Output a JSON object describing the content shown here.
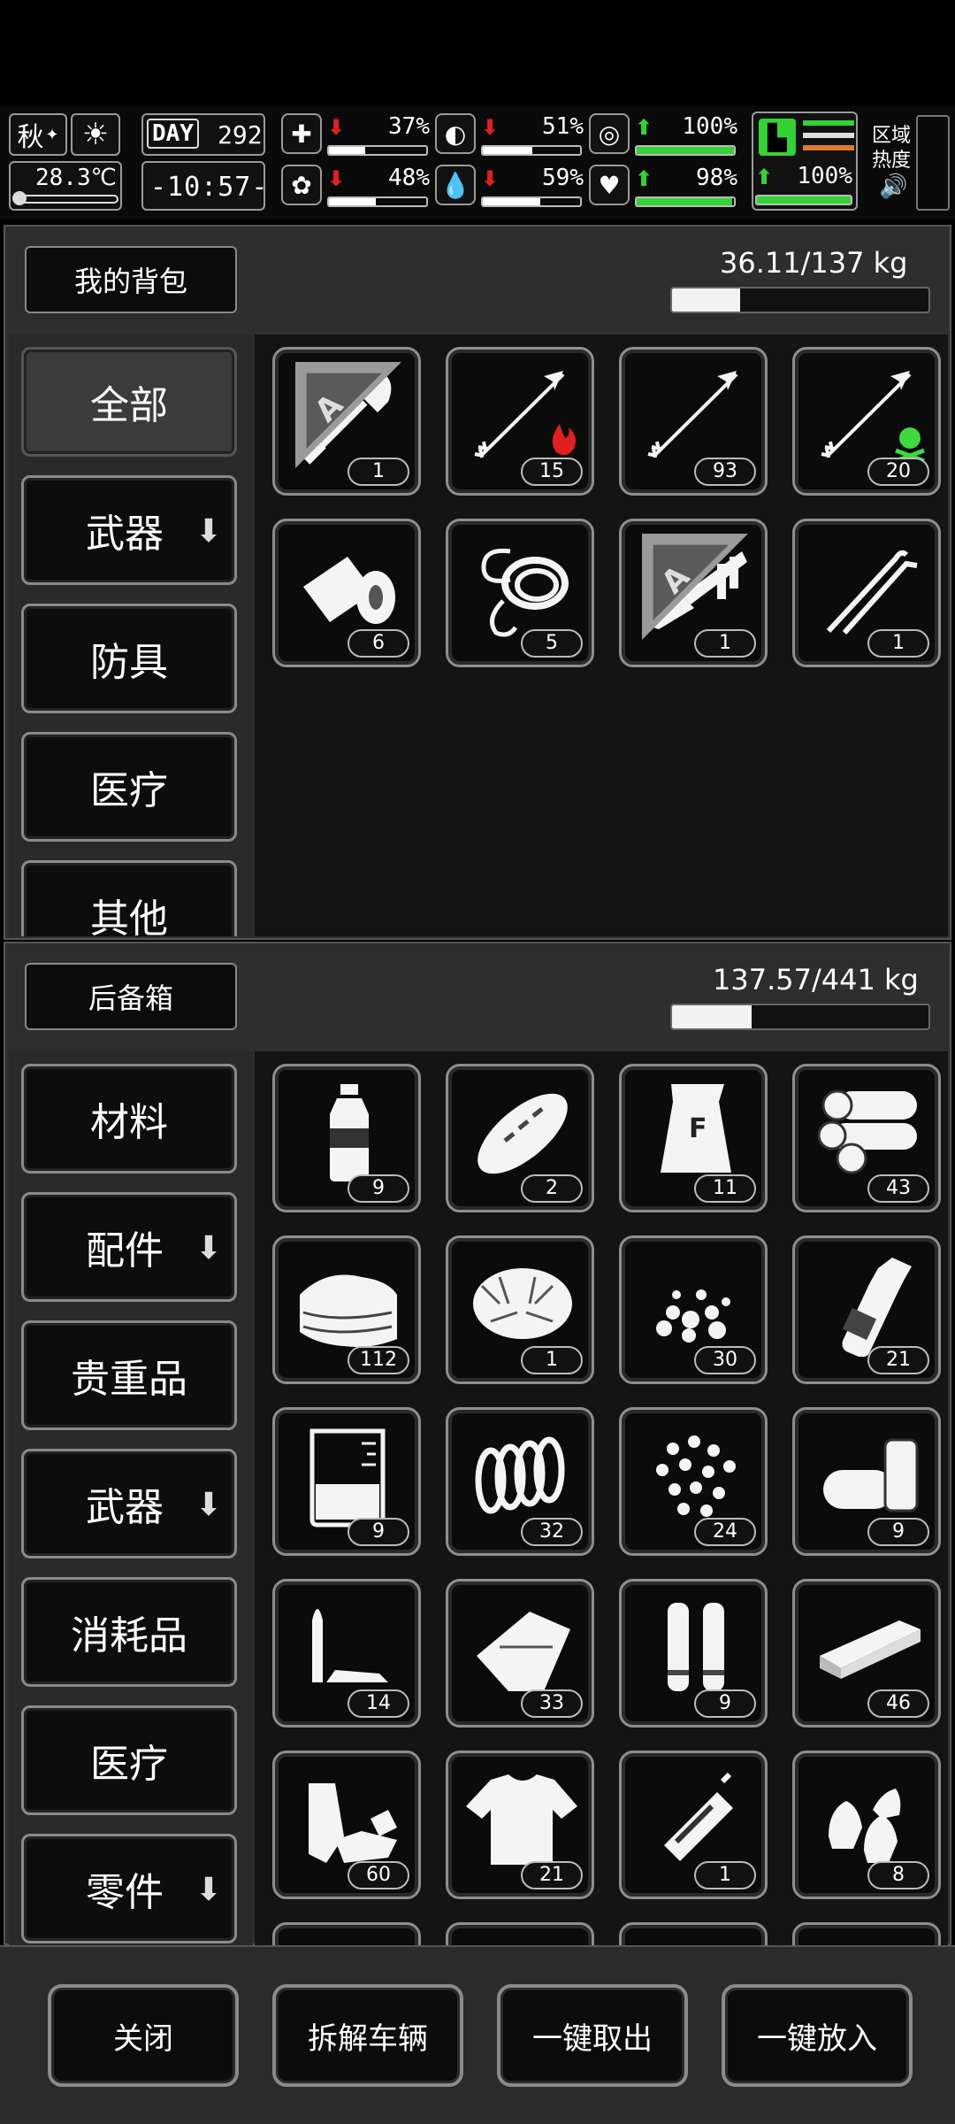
{
  "status": {
    "season": "秋",
    "temperature": "28.3℃",
    "day_label": "DAY",
    "day": "292",
    "time": "-10:57-",
    "stats": [
      {
        "icon": "medkit-icon",
        "glyph": "✚",
        "trend": "down",
        "value": "37%",
        "level": 0.37
      },
      {
        "icon": "stomach-icon",
        "glyph": "◐",
        "trend": "down",
        "value": "51%",
        "level": 0.51
      },
      {
        "icon": "armor-icon",
        "glyph": "◎",
        "trend": "up",
        "value": "100%",
        "level": 1.0
      },
      {
        "icon": "brain-icon",
        "glyph": "✿",
        "trend": "down",
        "value": "48%",
        "level": 0.48
      },
      {
        "icon": "water-drop-icon",
        "glyph": "💧",
        "trend": "down",
        "value": "59%",
        "level": 0.59
      },
      {
        "icon": "heart-icon",
        "glyph": "♥",
        "trend": "up",
        "value": "98%",
        "level": 0.98
      }
    ],
    "stamina": {
      "trend": "up",
      "value": "100%",
      "level": 1.0
    },
    "zone": {
      "line1": "区域",
      "line2": "热度"
    }
  },
  "backpack": {
    "title": "我的背包",
    "weight": "36.11/137 kg",
    "fill": 0.264,
    "categories": [
      {
        "label": "全部",
        "selected": true,
        "arrow": false
      },
      {
        "label": "武器",
        "selected": false,
        "arrow": true
      },
      {
        "label": "防具",
        "selected": false,
        "arrow": false
      },
      {
        "label": "医疗",
        "selected": false,
        "arrow": false
      },
      {
        "label": "其他",
        "selected": false,
        "arrow": false
      }
    ],
    "items": [
      {
        "icon": "shovel-icon",
        "count": "1",
        "tag": "A"
      },
      {
        "icon": "fire-arrow-icon",
        "count": "15"
      },
      {
        "icon": "arrow-icon",
        "count": "93"
      },
      {
        "icon": "poison-arrow-icon",
        "count": "20"
      },
      {
        "icon": "bandage-icon",
        "count": "6"
      },
      {
        "icon": "rope-icon",
        "count": "5"
      },
      {
        "icon": "caliper-knife-icon",
        "count": "1",
        "tag": "A"
      },
      {
        "icon": "lockpick-icon",
        "count": "1"
      }
    ]
  },
  "storage": {
    "title": "后备箱",
    "weight": "137.57/441 kg",
    "fill": 0.312,
    "categories": [
      {
        "label": "材料",
        "arrow": false
      },
      {
        "label": "配件",
        "arrow": true
      },
      {
        "label": "贵重品",
        "arrow": false
      },
      {
        "label": "武器",
        "arrow": true
      },
      {
        "label": "消耗品",
        "arrow": false
      },
      {
        "label": "医疗",
        "arrow": false
      },
      {
        "label": "零件",
        "arrow": true
      }
    ],
    "items": [
      {
        "icon": "water-bottle-icon",
        "count": "9"
      },
      {
        "icon": "bread-icon",
        "count": "2"
      },
      {
        "icon": "flour-sack-icon",
        "count": "11"
      },
      {
        "icon": "logs-icon",
        "count": "43"
      },
      {
        "icon": "cloth-icon",
        "count": "112"
      },
      {
        "icon": "fiber-icon",
        "count": "1"
      },
      {
        "icon": "gravel-icon",
        "count": "30"
      },
      {
        "icon": "glass-bottle-icon",
        "count": "21"
      },
      {
        "icon": "beaker-icon",
        "count": "9"
      },
      {
        "icon": "spring-icon",
        "count": "32"
      },
      {
        "icon": "pellets-icon",
        "count": "24"
      },
      {
        "icon": "pipes-icon",
        "count": "9"
      },
      {
        "icon": "bullet-icon",
        "count": "14"
      },
      {
        "icon": "leather-icon",
        "count": "33"
      },
      {
        "icon": "cartridges-icon",
        "count": "9"
      },
      {
        "icon": "plank-icon",
        "count": "46"
      },
      {
        "icon": "rags-icon",
        "count": "60"
      },
      {
        "icon": "shirt-icon",
        "count": "21"
      },
      {
        "icon": "battery-icon",
        "count": "1"
      },
      {
        "icon": "rounds-icon",
        "count": "8"
      }
    ]
  },
  "actions": [
    "关闭",
    "拆解车辆",
    "一键取出",
    "一键放入"
  ],
  "colors": {
    "green": "#35d235",
    "red": "#e02020",
    "poison": "#3fd83f"
  }
}
